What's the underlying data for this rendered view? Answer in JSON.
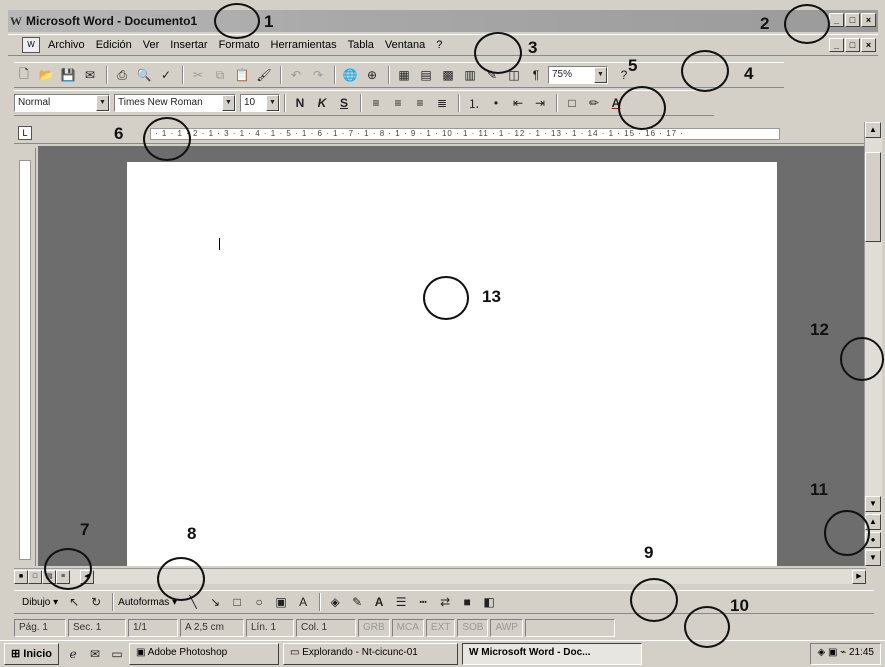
{
  "window": {
    "icon": "word-icon",
    "title": "Microsoft Word - Documento1",
    "controls": [
      "_",
      "□",
      "×"
    ]
  },
  "menu": {
    "items": [
      "Archivo",
      "Edición",
      "Ver",
      "Insertar",
      "Formato",
      "Herramientas",
      "Tabla",
      "Ventana",
      "?"
    ]
  },
  "standard_toolbar": {
    "zoom_value": "75%"
  },
  "format_toolbar": {
    "style": "Normal",
    "font": "Times New Roman",
    "size": "10",
    "bold": "N",
    "italic": "K",
    "underline": "S"
  },
  "ruler": {
    "marks": "· 1 · 1 · 2 · 1 · 3 · 1 · 4 · 1 · 5 · 1 · 6 · 1 · 7 · 1 · 8 · 1 · 9 · 1 · 10 · 1 · 11 · 1 · 12 · 1 · 13 · 1 · 14 · 1 · 15 · 16 · 17 ·"
  },
  "drawing_toolbar": {
    "draw_label": "Dibujo ▾",
    "autoshapes_label": "Autoformas ▾"
  },
  "statusbar": {
    "page": "Pág. 1",
    "section": "Sec. 1",
    "pages": "1/1",
    "position": "A 2,5 cm",
    "line": "Lín. 1",
    "column": "Col. 1",
    "flags": [
      "GRB",
      "MCA",
      "EXT",
      "SOB",
      "AWP"
    ]
  },
  "taskbar": {
    "start": "Inicio",
    "tasks": [
      "Adobe Photoshop",
      "Explorando - Nt-cicunc-01",
      "Microsoft Word - Doc..."
    ],
    "clock": "21:45"
  },
  "annotations": [
    "1",
    "2",
    "3",
    "4",
    "5",
    "6",
    "7",
    "8",
    "9",
    "10",
    "11",
    "12",
    "13"
  ]
}
